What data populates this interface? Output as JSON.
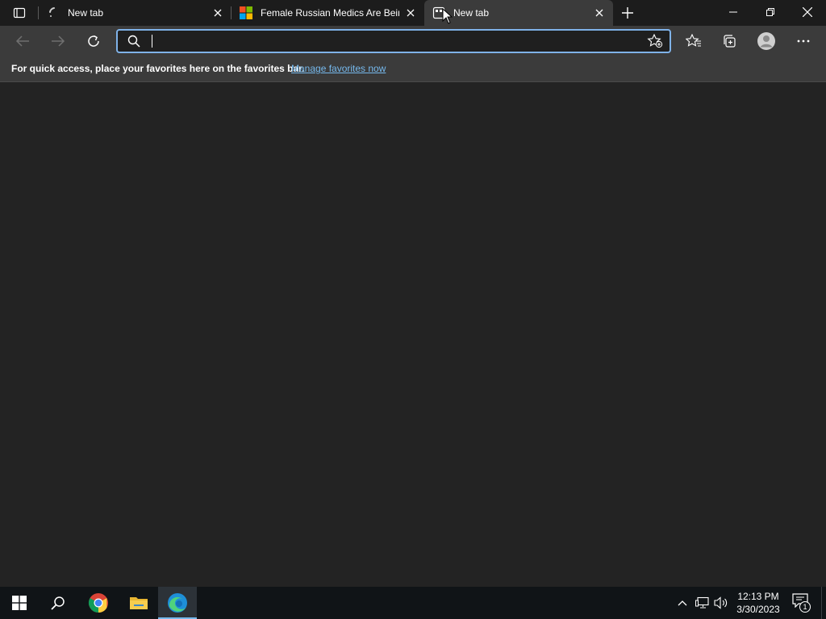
{
  "tabs": [
    {
      "title": "New tab",
      "active": false
    },
    {
      "title": "Female Russian Medics Are Being",
      "active": false
    },
    {
      "title": "New tab",
      "active": true
    }
  ],
  "omnibox": {
    "value": "",
    "placeholder": ""
  },
  "favorites_bar": {
    "message": "For quick access, place your favorites here on the favorites bar.",
    "link": "Manage favorites now"
  },
  "taskbar": {
    "time": "12:13 PM",
    "date": "3/30/2023",
    "notification_count": "1"
  },
  "colors": {
    "accent": "#76b9ed",
    "omnibox_border": "#7fb2e8",
    "background": "#232323"
  }
}
